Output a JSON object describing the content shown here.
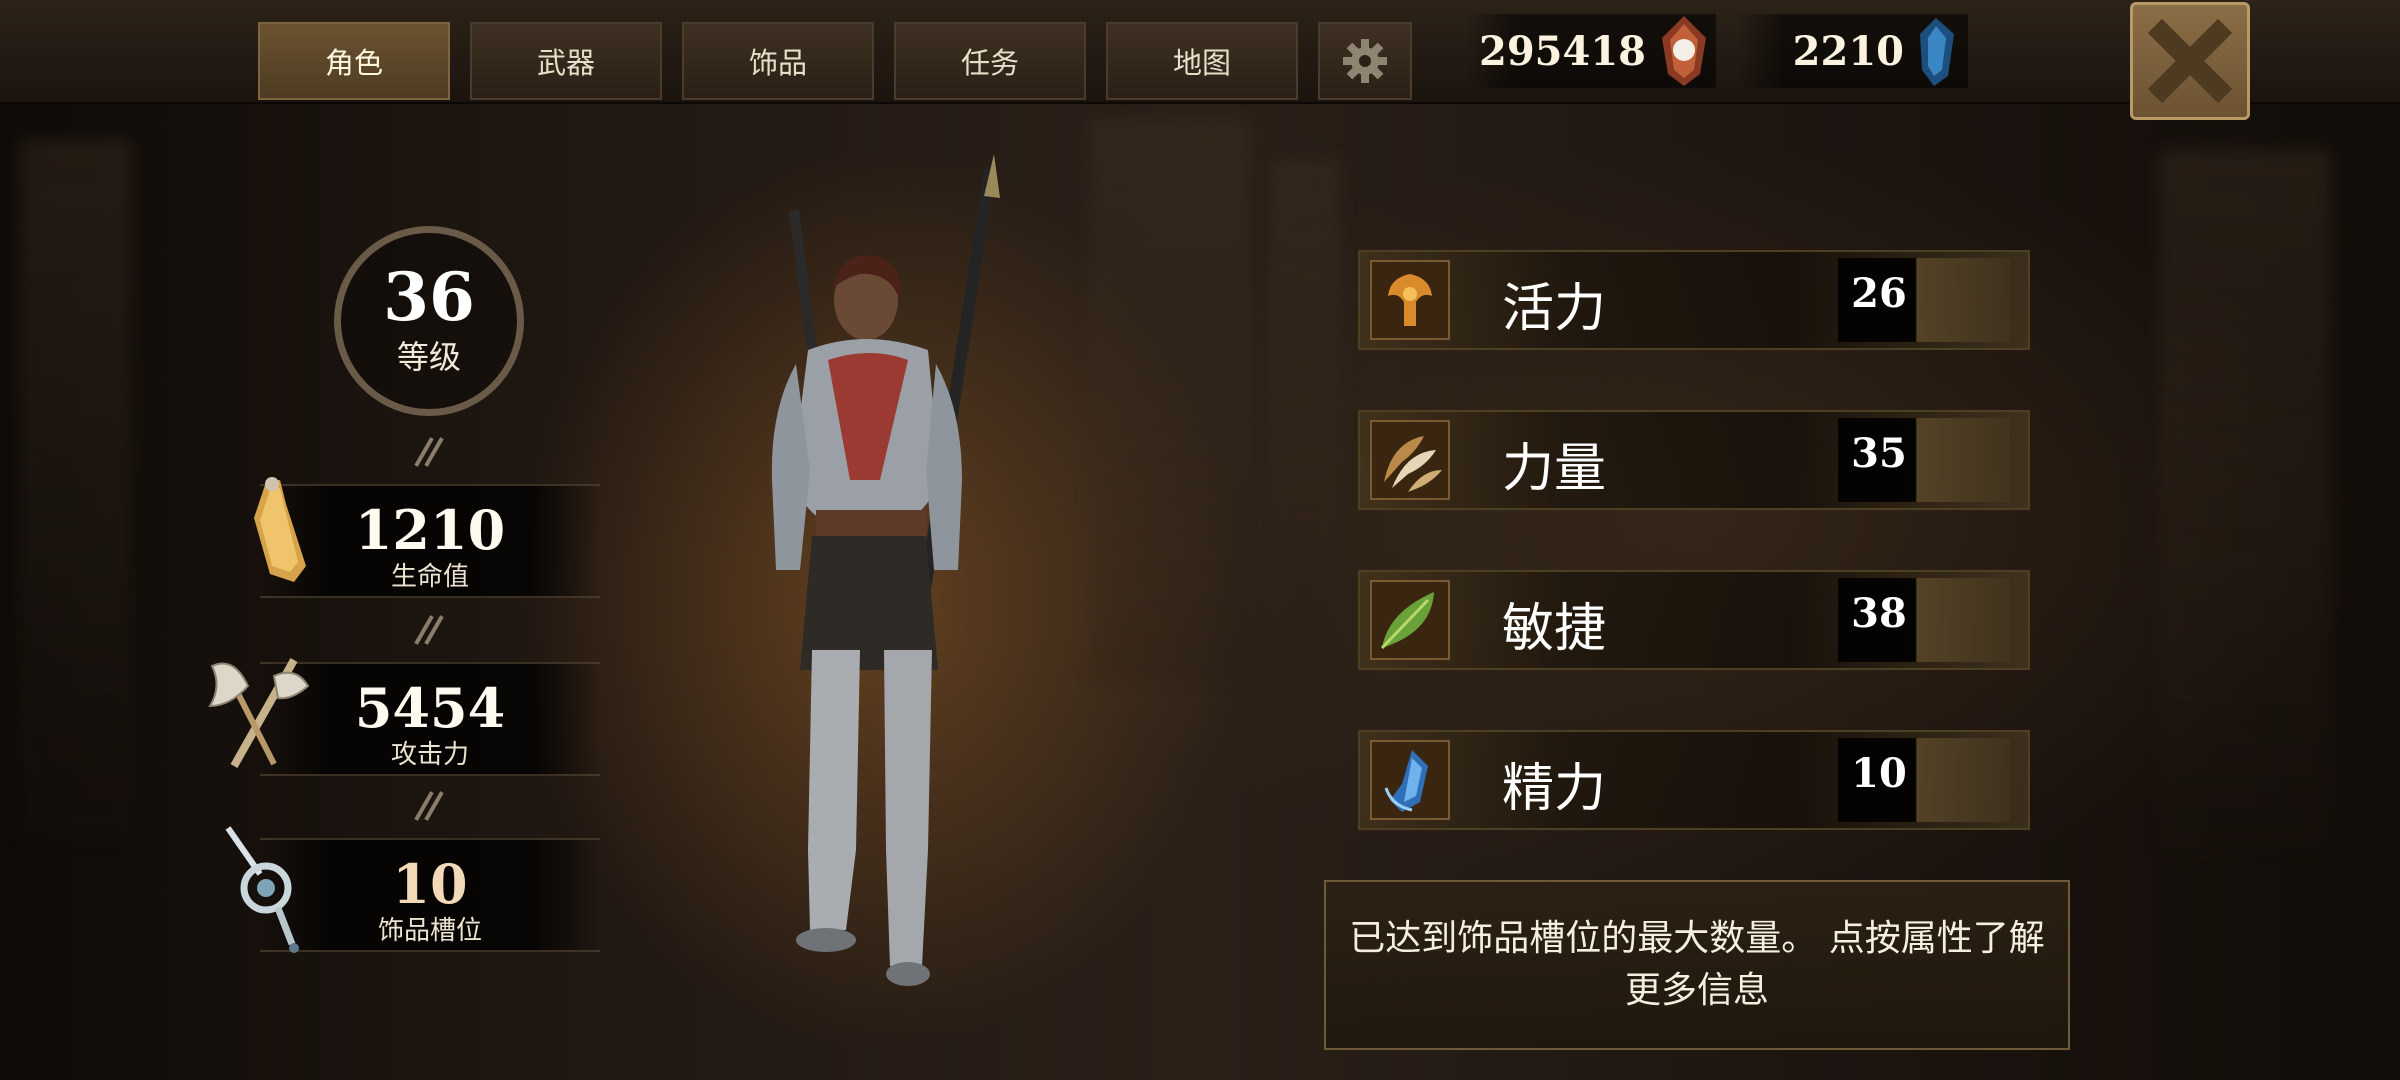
{
  "tabs": [
    {
      "label": "角色",
      "active": true
    },
    {
      "label": "武器",
      "active": false
    },
    {
      "label": "饰品",
      "active": false
    },
    {
      "label": "任务",
      "active": false
    },
    {
      "label": "地图",
      "active": false
    }
  ],
  "settings_icon": "gear-icon",
  "currency": {
    "gold": {
      "value": "295418",
      "icon": "gem-orb-icon"
    },
    "crystal": {
      "value": "2210",
      "icon": "blue-crystal-icon"
    }
  },
  "close_icon": "close-icon",
  "level": {
    "value": "36",
    "label": "等级"
  },
  "stats": [
    {
      "value": "1210",
      "label": "生命值",
      "icon": "health-scroll-icon"
    },
    {
      "value": "5454",
      "label": "攻击力",
      "icon": "crossed-axe-icon"
    },
    {
      "value": "10",
      "label": "饰品槽位",
      "icon": "amulet-slot-icon"
    }
  ],
  "attributes": [
    {
      "name": "活力",
      "value": "26",
      "icon": "vitality-icon",
      "color": "#c07a2a"
    },
    {
      "name": "力量",
      "value": "35",
      "icon": "strength-claw-icon",
      "color": "#a8753a"
    },
    {
      "name": "敏捷",
      "value": "38",
      "icon": "agility-leaf-icon",
      "color": "#6a9a30"
    },
    {
      "name": "精力",
      "value": "10",
      "icon": "energy-crystal-icon",
      "color": "#2f6fb8"
    }
  ],
  "info_text": "已达到饰品槽位的最大数量。 点按属性了解更多信息",
  "colors": {
    "accent": "#6b5330",
    "panel_border": "#6e5a36",
    "text": "#f2ead8"
  }
}
